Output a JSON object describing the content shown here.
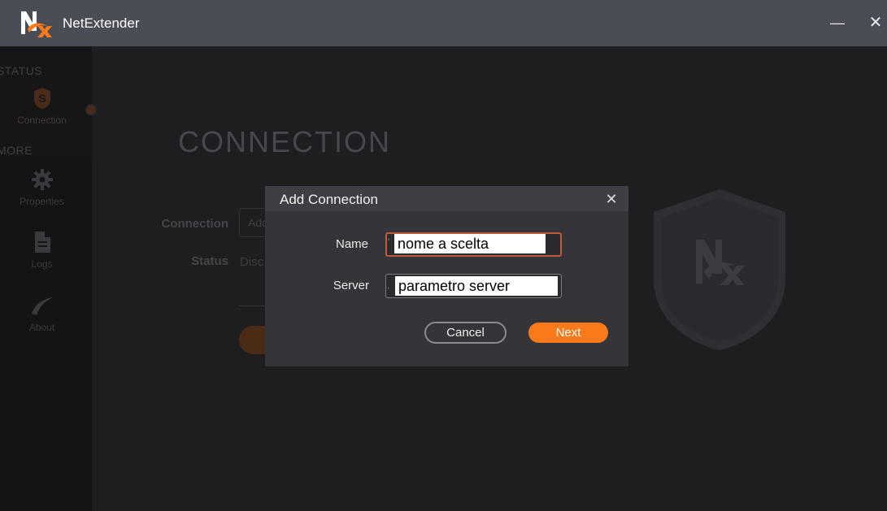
{
  "window": {
    "title": "NetExtender",
    "minimize_glyph": "—",
    "close_glyph": "✕"
  },
  "sidebar": {
    "section_status": "STATUS",
    "section_more": "MORE",
    "items": [
      {
        "label": "Connection",
        "icon": "shield-s-icon",
        "active": true
      },
      {
        "label": "Properties",
        "icon": "gear-icon",
        "active": false
      },
      {
        "label": "Logs",
        "icon": "document-icon",
        "active": false
      },
      {
        "label": "About",
        "icon": "swoosh-icon",
        "active": false
      }
    ]
  },
  "main": {
    "title": "CONNECTION",
    "connection_label": "Connection",
    "connection_value": "Add",
    "status_label": "Status",
    "status_value": "Disc"
  },
  "dialog": {
    "title": "Add Connection",
    "close_glyph": "✕",
    "name_label": "Name",
    "name_value": "nome a scelta",
    "server_label": "Server",
    "server_value": "parametro server",
    "cancel_label": "Cancel",
    "next_label": "Next"
  },
  "colors": {
    "titlebar": "#4a4d56",
    "accent": "#fd7a1a",
    "dialog_bg": "#343439",
    "background": "#1e1e21"
  }
}
